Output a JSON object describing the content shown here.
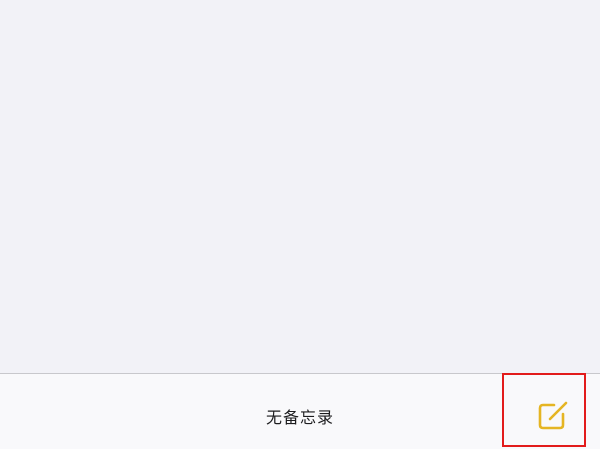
{
  "main": {
    "empty_label": "无备忘录"
  },
  "toolbar": {
    "compose_icon": "compose-icon",
    "accent_color": "#e5b523",
    "highlight_color": "#e21b1b"
  }
}
